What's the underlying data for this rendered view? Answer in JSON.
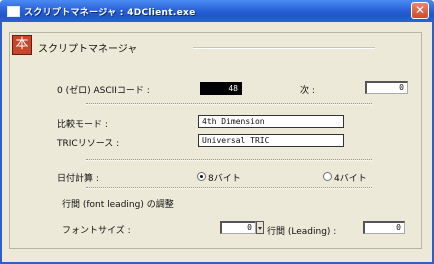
{
  "window": {
    "title": "スクリプトマネージャ : 4DClient.exe",
    "close_glyph": "✕"
  },
  "panel": {
    "header_label": "スクリプトマネージャ",
    "app_icon_glyph": "本"
  },
  "zero_ascii": {
    "label": "0 (ゼロ) ASCIIコード :",
    "value": "48",
    "next_label": "次 :",
    "next_value": "0"
  },
  "compare_mode": {
    "label": "比較モード :",
    "value": "4th Dimension"
  },
  "tric_resource": {
    "label": "TRICリソース :",
    "value": "Universal TRIC"
  },
  "date_calc": {
    "label": "日付計算 :",
    "options": [
      {
        "label": "8バイト",
        "selected": true
      },
      {
        "label": "4バイト",
        "selected": false
      }
    ]
  },
  "line_spacing": {
    "section_label": "行間 (font leading) の調整",
    "font_size_label": "フォントサイズ :",
    "font_size_value": "0",
    "leading_label": "行間 (Leading) :",
    "leading_value": "0"
  },
  "colors": {
    "titlebar": "#2a63d8",
    "window_bg": "#ece9d8",
    "close_button": "#d04a26"
  }
}
